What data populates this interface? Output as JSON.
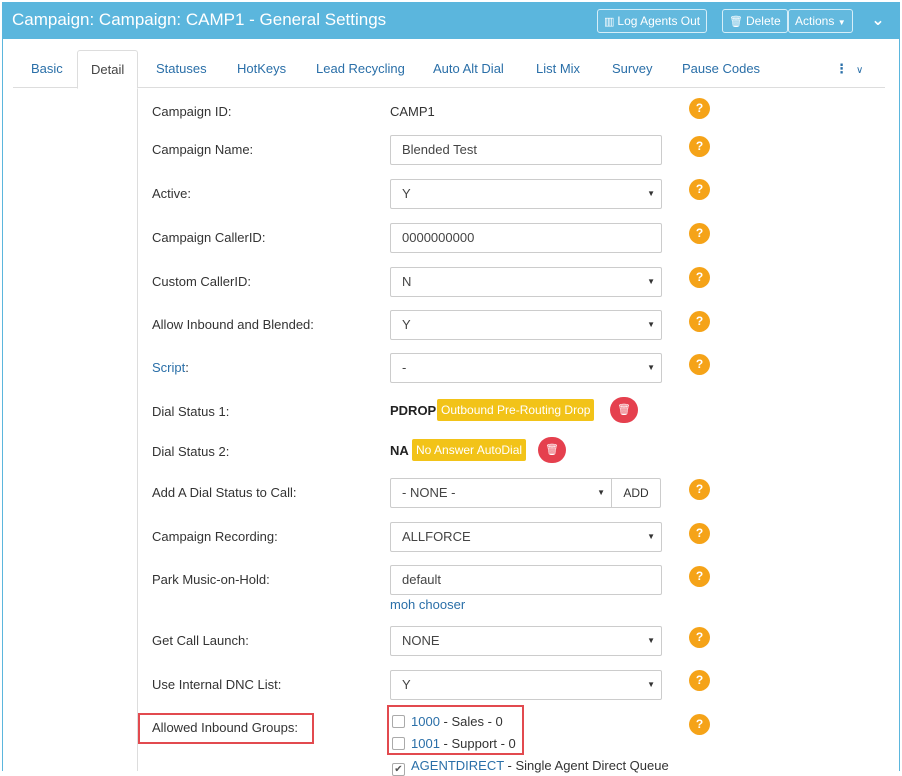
{
  "header": {
    "title": "Campaign: Campaign: CAMP1 - General Settings",
    "log_agents_out": "Log Agents Out",
    "delete": "Delete",
    "actions": "Actions",
    "bg_color": "#5bb6dd"
  },
  "tabs": [
    "Basic",
    "Detail",
    "Statuses",
    "HotKeys",
    "Lead Recycling",
    "Auto Alt Dial",
    "List Mix",
    "Survey",
    "Pause Codes"
  ],
  "active_tab": "Detail",
  "help_icon": "?",
  "fields": {
    "campaign_id": {
      "label": "Campaign ID:",
      "value": "CAMP1"
    },
    "campaign_name": {
      "label": "Campaign Name:",
      "value": "Blended Test"
    },
    "active": {
      "label": "Active:",
      "value": "Y"
    },
    "campaign_callerid": {
      "label": "Campaign CallerID:",
      "value": "0000000000"
    },
    "custom_callerid": {
      "label": "Custom CallerID:",
      "value": "N"
    },
    "allow_inbound": {
      "label": "Allow Inbound and Blended:",
      "value": "Y"
    },
    "script": {
      "label": "Script",
      "value": "-"
    },
    "dial_status_1": {
      "label": "Dial Status 1:",
      "code": "PDROP",
      "badge": "Outbound Pre-Routing Drop"
    },
    "dial_status_2": {
      "label": "Dial Status 2:",
      "code": "NA",
      "badge": "No Answer AutoDial"
    },
    "add_dial_status": {
      "label": "Add A Dial Status to Call:",
      "value": "- NONE -",
      "button": "ADD"
    },
    "campaign_recording": {
      "label": "Campaign Recording:",
      "value": "ALLFORCE"
    },
    "park_moh": {
      "label": "Park Music-on-Hold:",
      "value": "default",
      "link": "moh chooser"
    },
    "get_call_launch": {
      "label": "Get Call Launch:",
      "value": "NONE"
    },
    "internal_dnc": {
      "label": "Use Internal DNC List:",
      "value": "Y"
    },
    "allowed_inbound_groups": {
      "label": "Allowed Inbound Groups:",
      "groups": [
        {
          "id": "1000",
          "desc": " - Sales - 0",
          "checked": false
        },
        {
          "id": "1001",
          "desc": " - Support - 0",
          "checked": false
        },
        {
          "id": "AGENTDIRECT",
          "desc": " - Single Agent Direct Queue",
          "checked": true
        }
      ]
    }
  },
  "colors": {
    "help": "#f5a318",
    "badge": "#f2c318",
    "trash": "#e5404e",
    "highlight": "#e24a4f",
    "link": "#2a6fa8"
  }
}
